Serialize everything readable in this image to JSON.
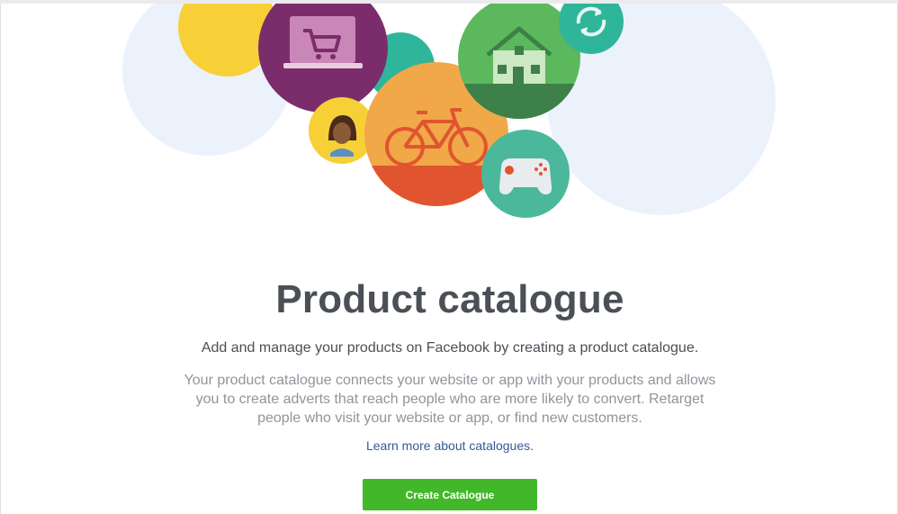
{
  "page": {
    "title": "Product catalogue",
    "subtitle": "Add and manage your products on Facebook by creating a product catalogue.",
    "description": "Your product catalogue connects your website or app with your products and allows you to create adverts that reach people who are more likely to convert. Retarget people who visit your website or app, or find new customers.",
    "learn_more_link": "Learn more about catalogues.",
    "create_button": "Create Catalogue"
  },
  "illustration": {
    "icons": [
      "shopping-cart-laptop-icon",
      "person-avatar-icon",
      "bicycle-icon",
      "house-icon",
      "refresh-icon",
      "game-controller-icon"
    ]
  },
  "colors": {
    "accent_button": "#42b72a",
    "link": "#365899",
    "title_text": "#4b4f56",
    "muted_text": "#90949c"
  }
}
